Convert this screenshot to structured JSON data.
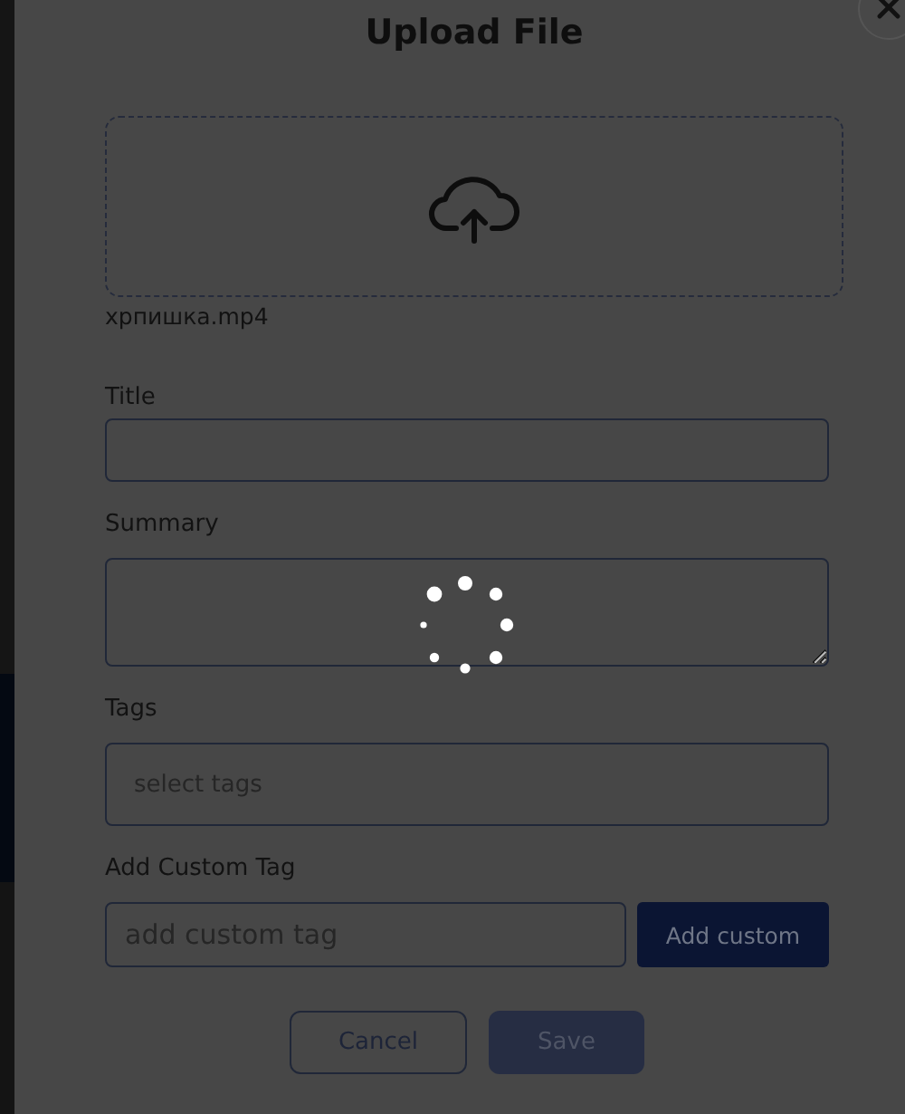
{
  "modal": {
    "title": "Upload File",
    "file_name": "хрпишка.mp4",
    "fields": [
      {
        "kind": "input",
        "label": "Title"
      },
      {
        "kind": "textarea",
        "label": "Summary"
      },
      {
        "kind": "select",
        "label": "Tags",
        "placeholder": "select tags"
      }
    ],
    "custom_tag": {
      "label": "Add Custom Tag",
      "placeholder": "add custom tag",
      "button": "Add custom"
    },
    "buttons": [
      {
        "kind": "secondary",
        "label": "Cancel",
        "disabled": false
      },
      {
        "kind": "primary",
        "label": "Save",
        "disabled": true
      }
    ],
    "loading": true
  }
}
